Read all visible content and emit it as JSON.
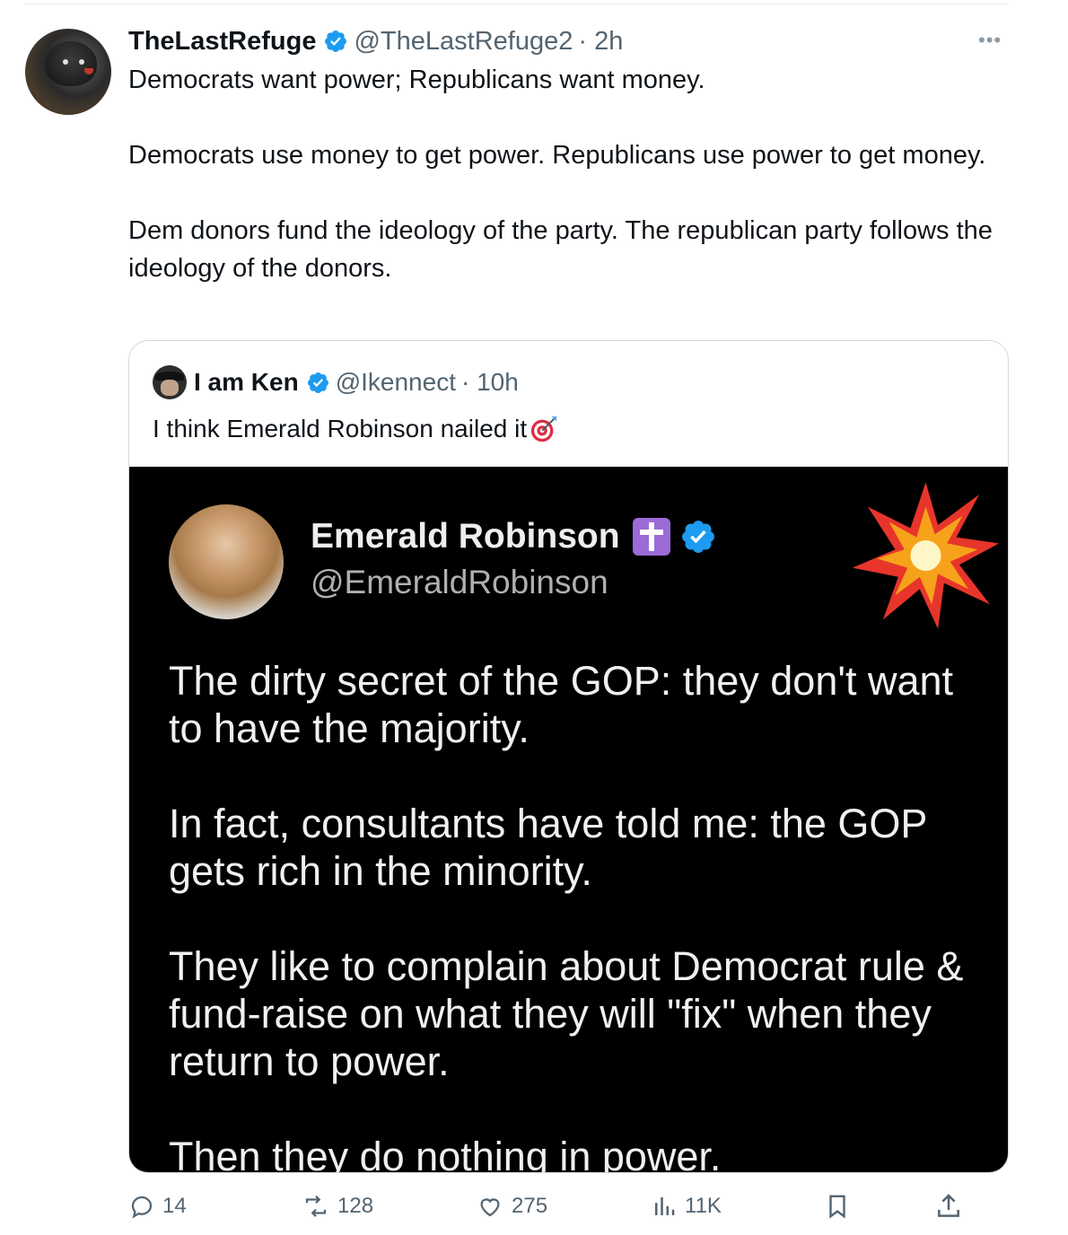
{
  "tweet": {
    "author_name": "TheLastRefuge",
    "handle": "@TheLastRefuge2",
    "time": "· 2h",
    "paragraphs": [
      "Democrats want power; Republicans want money.",
      "Democrats use money to get power. Republicans use power to get money.",
      "Dem donors fund the ideology of the party. The republican party follows the ideology of the donors."
    ]
  },
  "quote": {
    "author_name": "I am Ken",
    "handle": "@Ikennect",
    "time": "· 10h",
    "text": "I think Emerald Robinson nailed it",
    "image": {
      "name": "Emerald Robinson",
      "handle": "@EmeraldRobinson",
      "paragraphs": [
        "The dirty secret of the GOP: they don't want to have the majority.",
        "In fact, consultants have told me: the GOP gets rich in the minority.",
        "They like to complain about Democrat rule & fund-raise on what they will \"fix\" when they return to power.",
        "Then they do nothing in power."
      ]
    }
  },
  "actions": {
    "replies": "14",
    "reposts": "128",
    "likes": "275",
    "views": "11K"
  },
  "colors": {
    "verified": "#1d9bf0",
    "muted": "#536471",
    "border": "#cfd9de"
  }
}
